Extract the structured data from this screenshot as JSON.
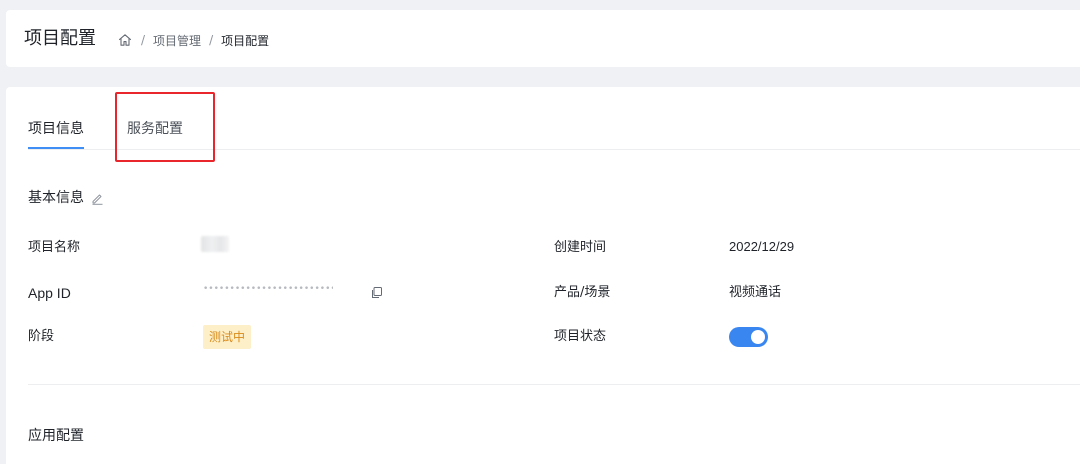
{
  "header": {
    "title": "项目配置",
    "breadcrumb": {
      "home_icon": "home-icon",
      "separator": "/",
      "items": [
        "项目管理",
        "项目配置"
      ]
    }
  },
  "tabs": [
    {
      "label": "项目信息",
      "active": true
    },
    {
      "label": "服务配置",
      "active": false
    }
  ],
  "basic_info": {
    "title": "基本信息",
    "edit_icon": "edit-pencil-icon",
    "fields": {
      "project_name": {
        "label": "项目名称"
      },
      "app_id": {
        "label": "App ID",
        "masked_value": "••••••••••••••••••••••••••••••••••",
        "copy_icon": "copy-icon"
      },
      "stage": {
        "label": "阶段",
        "value": "测试中"
      },
      "created_time": {
        "label": "创建时间",
        "value": "2022/12/29"
      },
      "product_scene": {
        "label": "产品/场景",
        "value": "视频通话"
      },
      "project_status": {
        "label": "项目状态",
        "enabled": true
      }
    }
  },
  "app_config": {
    "title": "应用配置"
  },
  "colors": {
    "accent": "#3f8ef5",
    "toggle_on": "#3a86f0",
    "badge_bg": "#fdf0c9",
    "badge_text": "#d98a1b",
    "highlight_border": "#e8262b"
  }
}
